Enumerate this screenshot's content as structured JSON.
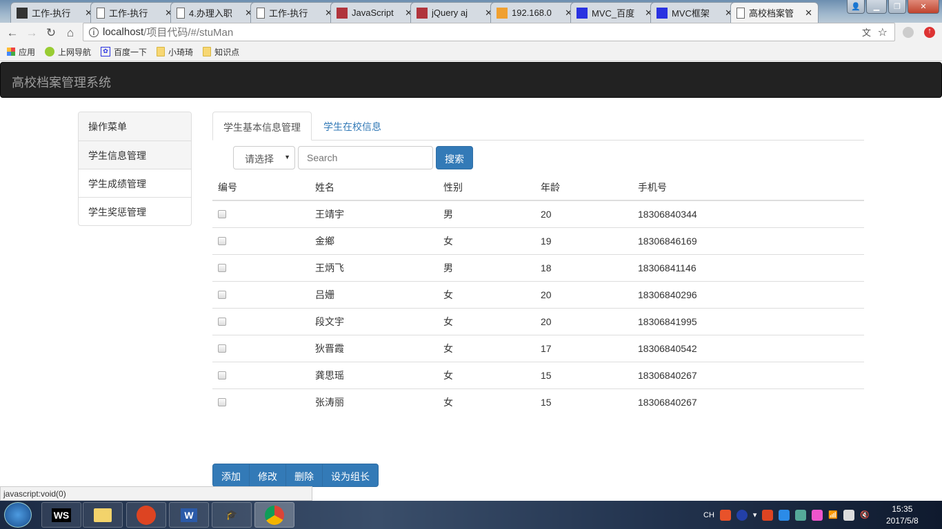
{
  "browser": {
    "tabs": [
      {
        "title": "工作-执行",
        "icon": "webstorm-icon",
        "color": "#333"
      },
      {
        "title": "工作-执行",
        "icon": "page-icon",
        "color": ""
      },
      {
        "title": "4.办理入职",
        "icon": "page-icon",
        "color": ""
      },
      {
        "title": "工作-执行",
        "icon": "page-icon",
        "color": ""
      },
      {
        "title": "JavaScript",
        "icon": "w3-icon",
        "color": "#b0343c"
      },
      {
        "title": "jQuery aj",
        "icon": "w3-icon",
        "color": "#b0343c"
      },
      {
        "title": "192.168.0",
        "icon": "pma-icon",
        "color": "#f0a030"
      },
      {
        "title": "MVC_百度",
        "icon": "baidu-icon",
        "color": "#2932e1"
      },
      {
        "title": "MVC框架",
        "icon": "baidu-icon",
        "color": "#2932e1"
      },
      {
        "title": "高校档案管",
        "icon": "page-icon",
        "color": ""
      }
    ],
    "close_glyph": "✕",
    "url_host": "localhost",
    "url_path": "/项目代码/#/stuMan",
    "bookmarks": [
      "应用",
      "上网导航",
      "百度一下",
      "小琦琦",
      "知识点"
    ],
    "status_text": "javascript:void(0)"
  },
  "app": {
    "brand": "高校档案管理系统",
    "menu": {
      "header": "操作菜单",
      "items": [
        "学生信息管理",
        "学生成绩管理",
        "学生奖惩管理"
      ]
    },
    "tabs": [
      "学生基本信息管理",
      "学生在校信息"
    ],
    "select": "请选择",
    "search_placeholder": "Search",
    "search_button": "搜索",
    "table": {
      "headers": [
        "编号",
        "姓名",
        "性别",
        "年龄",
        "手机号"
      ],
      "rows": [
        {
          "name": "王靖宇",
          "sex": "男",
          "age": "20",
          "phone": "18306840344"
        },
        {
          "name": "金鄉",
          "sex": "女",
          "age": "19",
          "phone": "18306846169"
        },
        {
          "name": "王炳飞",
          "sex": "男",
          "age": "18",
          "phone": "18306841146"
        },
        {
          "name": "吕姗",
          "sex": "女",
          "age": "20",
          "phone": "18306840296"
        },
        {
          "name": "段文宇",
          "sex": "女",
          "age": "20",
          "phone": "18306841995"
        },
        {
          "name": "狄晋霞",
          "sex": "女",
          "age": "17",
          "phone": "18306840542"
        },
        {
          "name": "龚思瑶",
          "sex": "女",
          "age": "15",
          "phone": "18306840267"
        },
        {
          "name": "张涛丽",
          "sex": "女",
          "age": "15",
          "phone": "18306840267"
        }
      ]
    },
    "actions": [
      "添加",
      "修改",
      "删除",
      "设为组长"
    ],
    "primary_color": "#337ab7"
  },
  "taskbar": {
    "apps": [
      "WS",
      "",
      "",
      "W",
      "",
      "Chrome"
    ],
    "lang": "CH",
    "time": "15:35",
    "date": "2017/5/8"
  }
}
